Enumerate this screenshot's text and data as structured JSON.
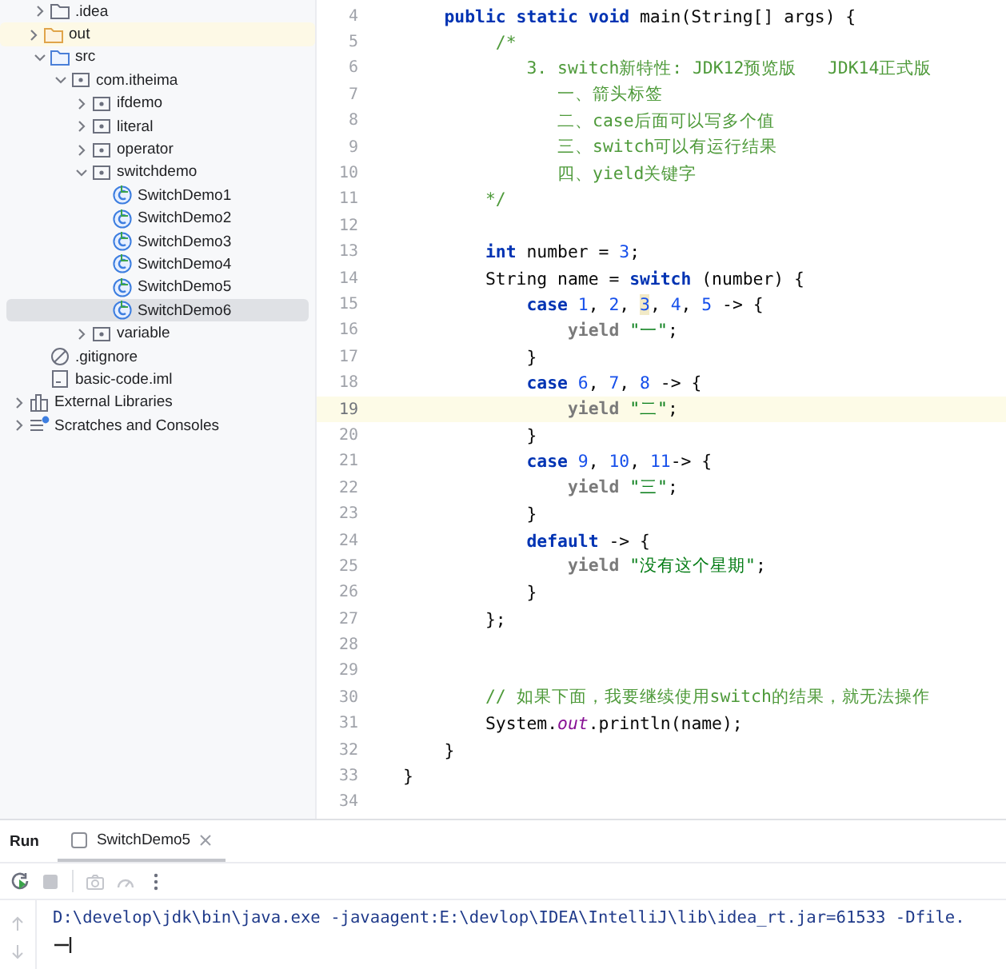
{
  "project_tree": {
    "project_children": [
      {
        "label": ".idea",
        "kind": "folder",
        "expanded": false,
        "selected": false
      },
      {
        "label": "out",
        "kind": "excluded-folder",
        "expanded": false,
        "selected": false
      },
      {
        "label": "src",
        "kind": "source-folder",
        "expanded": true,
        "selected": false,
        "children": [
          {
            "label": "com.itheima",
            "kind": "package",
            "expanded": true,
            "selected": false,
            "children": [
              {
                "label": "ifdemo",
                "kind": "package",
                "expanded": false,
                "selected": false
              },
              {
                "label": "literal",
                "kind": "package",
                "expanded": false,
                "selected": false
              },
              {
                "label": "operator",
                "kind": "package",
                "expanded": false,
                "selected": false
              },
              {
                "label": "switchdemo",
                "kind": "package",
                "expanded": true,
                "selected": false,
                "children": [
                  {
                    "label": "SwitchDemo1",
                    "kind": "class",
                    "selected": false
                  },
                  {
                    "label": "SwitchDemo2",
                    "kind": "class",
                    "selected": false
                  },
                  {
                    "label": "SwitchDemo3",
                    "kind": "class",
                    "selected": false
                  },
                  {
                    "label": "SwitchDemo4",
                    "kind": "class",
                    "selected": false
                  },
                  {
                    "label": "SwitchDemo5",
                    "kind": "class",
                    "selected": false
                  },
                  {
                    "label": "SwitchDemo6",
                    "kind": "class",
                    "selected": true
                  }
                ]
              },
              {
                "label": "variable",
                "kind": "package",
                "expanded": false,
                "selected": false
              }
            ]
          }
        ]
      },
      {
        "label": ".gitignore",
        "kind": "ignore-file",
        "selected": false
      },
      {
        "label": "basic-code.iml",
        "kind": "module-file",
        "selected": false
      }
    ],
    "roots": [
      {
        "label": "External Libraries",
        "kind": "libraries",
        "expanded": false,
        "selected": false
      },
      {
        "label": "Scratches and Consoles",
        "kind": "scratches",
        "expanded": false,
        "selected": false
      }
    ]
  },
  "editor": {
    "lines": [
      {
        "number": "4",
        "current": false,
        "tokens": [
          {
            "kind": "keyword",
            "text": "    public static void"
          },
          {
            "kind": "plain",
            "text": " main(String[] args) {"
          }
        ]
      },
      {
        "number": "5",
        "current": false,
        "tokens": [
          {
            "kind": "comment",
            "text": "         /*"
          }
        ]
      },
      {
        "number": "6",
        "current": false,
        "tokens": [
          {
            "kind": "comment",
            "text": "            3. switch新特性: JDK12预览版   JDK14正式版"
          }
        ]
      },
      {
        "number": "7",
        "current": false,
        "tokens": [
          {
            "kind": "comment",
            "text": "               一、箭头标签"
          }
        ]
      },
      {
        "number": "8",
        "current": false,
        "tokens": [
          {
            "kind": "comment",
            "text": "               二、case后面可以写多个值"
          }
        ]
      },
      {
        "number": "9",
        "current": false,
        "tokens": [
          {
            "kind": "comment",
            "text": "               三、switch可以有运行结果"
          }
        ]
      },
      {
        "number": "10",
        "current": false,
        "tokens": [
          {
            "kind": "comment",
            "text": "               四、yield关键字"
          }
        ]
      },
      {
        "number": "11",
        "current": false,
        "tokens": [
          {
            "kind": "comment",
            "text": "        */"
          }
        ]
      },
      {
        "number": "12",
        "current": false
      },
      {
        "number": "13",
        "current": false,
        "tokens": [
          {
            "kind": "keyword",
            "text": "        int"
          },
          {
            "kind": "plain",
            "text": " number = "
          },
          {
            "kind": "number",
            "text": "3"
          },
          {
            "kind": "plain",
            "text": ";"
          }
        ]
      },
      {
        "number": "14",
        "current": false,
        "tokens": [
          {
            "kind": "plain",
            "text": "        String name = "
          },
          {
            "kind": "keyword",
            "text": "switch"
          },
          {
            "kind": "plain",
            "text": " (number) {"
          }
        ]
      },
      {
        "number": "15",
        "current": false,
        "tokens": [
          {
            "kind": "keyword",
            "text": "            case "
          },
          {
            "kind": "number",
            "text": "1"
          },
          {
            "kind": "plain",
            "text": ", "
          },
          {
            "kind": "number",
            "text": "2"
          },
          {
            "kind": "plain",
            "text": ", "
          },
          {
            "kind": "caret-number",
            "text": "3"
          },
          {
            "kind": "plain",
            "text": ", "
          },
          {
            "kind": "number",
            "text": "4"
          },
          {
            "kind": "plain",
            "text": ", "
          },
          {
            "kind": "number",
            "text": "5"
          },
          {
            "kind": "plain",
            "text": " -> {"
          }
        ]
      },
      {
        "number": "16",
        "current": false,
        "tokens": [
          {
            "kind": "yield",
            "text": "                yield "
          },
          {
            "kind": "string",
            "text": "\"一\""
          },
          {
            "kind": "plain",
            "text": ";"
          }
        ]
      },
      {
        "number": "17",
        "current": false,
        "tokens": [
          {
            "kind": "plain",
            "text": "            }"
          }
        ]
      },
      {
        "number": "18",
        "current": false,
        "tokens": [
          {
            "kind": "keyword",
            "text": "            case "
          },
          {
            "kind": "number",
            "text": "6"
          },
          {
            "kind": "plain",
            "text": ", "
          },
          {
            "kind": "number",
            "text": "7"
          },
          {
            "kind": "plain",
            "text": ", "
          },
          {
            "kind": "number",
            "text": "8"
          },
          {
            "kind": "plain",
            "text": " -> {"
          }
        ]
      },
      {
        "number": "19",
        "current": true,
        "tokens": [
          {
            "kind": "yield",
            "text": "                yield "
          },
          {
            "kind": "string",
            "text": "\"二\""
          },
          {
            "kind": "plain",
            "text": ";"
          }
        ]
      },
      {
        "number": "20",
        "current": false,
        "tokens": [
          {
            "kind": "plain",
            "text": "            }"
          }
        ]
      },
      {
        "number": "21",
        "current": false,
        "tokens": [
          {
            "kind": "keyword",
            "text": "            case "
          },
          {
            "kind": "number",
            "text": "9"
          },
          {
            "kind": "plain",
            "text": ", "
          },
          {
            "kind": "number",
            "text": "10"
          },
          {
            "kind": "plain",
            "text": ", "
          },
          {
            "kind": "number",
            "text": "11"
          },
          {
            "kind": "plain",
            "text": "-> {"
          }
        ]
      },
      {
        "number": "22",
        "current": false,
        "tokens": [
          {
            "kind": "yield",
            "text": "                yield "
          },
          {
            "kind": "string",
            "text": "\"三\""
          },
          {
            "kind": "plain",
            "text": ";"
          }
        ]
      },
      {
        "number": "23",
        "current": false,
        "tokens": [
          {
            "kind": "plain",
            "text": "            }"
          }
        ]
      },
      {
        "number": "24",
        "current": false,
        "tokens": [
          {
            "kind": "keyword",
            "text": "            default"
          },
          {
            "kind": "plain",
            "text": " -> {"
          }
        ]
      },
      {
        "number": "25",
        "current": false,
        "tokens": [
          {
            "kind": "yield",
            "text": "                yield "
          },
          {
            "kind": "string",
            "text": "\"没有这个星期\""
          },
          {
            "kind": "plain",
            "text": ";"
          }
        ]
      },
      {
        "number": "26",
        "current": false,
        "tokens": [
          {
            "kind": "plain",
            "text": "            }"
          }
        ]
      },
      {
        "number": "27",
        "current": false,
        "tokens": [
          {
            "kind": "plain",
            "text": "        };"
          }
        ]
      },
      {
        "number": "28",
        "current": false
      },
      {
        "number": "29",
        "current": false
      },
      {
        "number": "30",
        "current": false,
        "tokens": [
          {
            "kind": "line-comment",
            "text": "        // 如果下面，我要继续使用switch的结果，就无法操作"
          }
        ]
      },
      {
        "number": "31",
        "current": false,
        "tokens": [
          {
            "kind": "plain",
            "text": "        System."
          },
          {
            "kind": "field",
            "text": "out"
          },
          {
            "kind": "plain",
            "text": ".println(name);"
          }
        ]
      },
      {
        "number": "32",
        "current": false,
        "tokens": [
          {
            "kind": "plain",
            "text": "    }"
          }
        ]
      },
      {
        "number": "33",
        "current": false,
        "tokens": [
          {
            "kind": "plain",
            "text": "}"
          }
        ]
      },
      {
        "number": "34",
        "current": false
      }
    ]
  },
  "run_panel": {
    "title": "Run",
    "tabs": [
      {
        "label": "SwitchDemo5",
        "selected": true
      }
    ],
    "console_lines": [
      "D:\\develop\\jdk\\bin\\java.exe -javaagent:E:\\devlop\\IDEA\\IntelliJ\\lib\\idea_rt.jar=61533 -Dfile."
    ]
  }
}
